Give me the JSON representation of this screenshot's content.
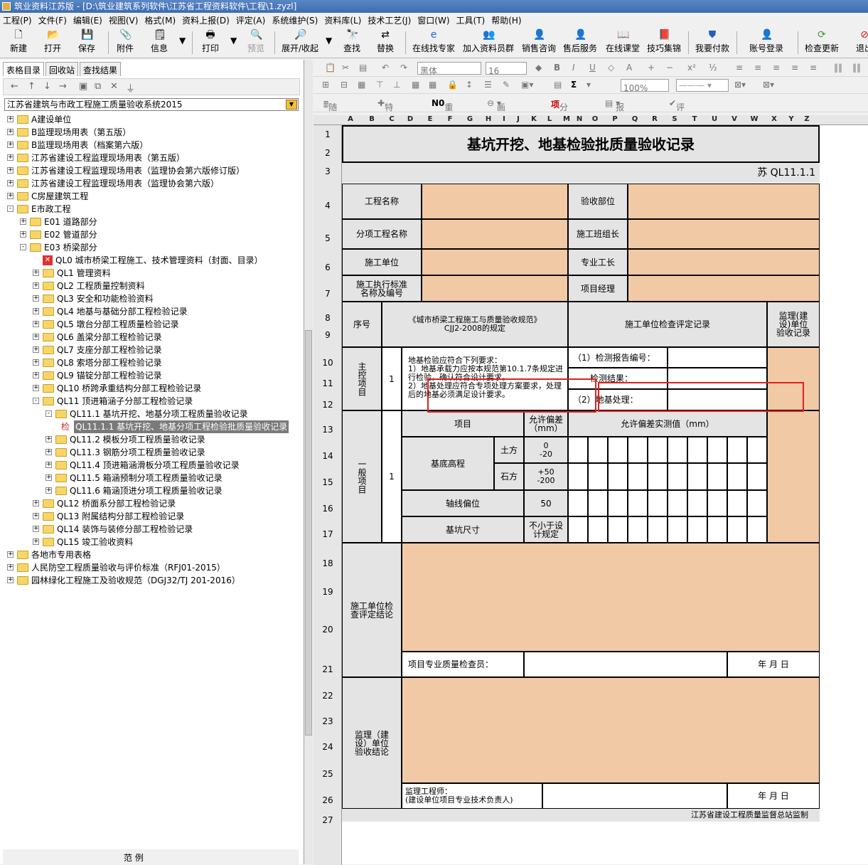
{
  "window": {
    "title": "筑业资料江苏版 - [D:\\筑业建筑系列软件\\江苏省工程资料软件\\工程\\1.zyzl]"
  },
  "menu": [
    "工程(P)",
    "文件(F)",
    "编辑(E)",
    "视图(V)",
    "格式(M)",
    "资料上报(D)",
    "评定(A)",
    "系统维护(S)",
    "资料库(L)",
    "技术工艺(J)",
    "窗口(W)",
    "工具(T)",
    "帮助(H)"
  ],
  "toolbar": {
    "new": "新建",
    "open": "打开",
    "save": "保存",
    "attach": "附件",
    "info": "信息",
    "print": "打印",
    "preview": "预览",
    "expand": "展开/收起",
    "find": "查找",
    "replace": "替换",
    "expert": "在线找专家",
    "group": "加入资料员群",
    "sales": "销售咨询",
    "aftersale": "售后服务",
    "class": "在线课堂",
    "tips": "技巧集锦",
    "pay": "我要付款",
    "account": "账号登录",
    "update": "检查更新",
    "exit": "退出"
  },
  "left": {
    "tabs": [
      "表格目录",
      "回收站",
      "查找结果"
    ],
    "combo": "江苏省建筑与市政工程施工质量验收系统2015",
    "tree": [
      {
        "label": "A建设单位",
        "level": 0,
        "exp": "+"
      },
      {
        "label": "B监理现场用表（第五版）",
        "level": 0,
        "exp": "+"
      },
      {
        "label": "B监理现场用表（档案第六版）",
        "level": 0,
        "exp": "+"
      },
      {
        "label": "江苏省建设工程监理现场用表（第五版）",
        "level": 0,
        "exp": "+"
      },
      {
        "label": "江苏省建设工程监理现场用表（监理协会第六版修订版）",
        "level": 0,
        "exp": "+"
      },
      {
        "label": "江苏省建设工程监理现场用表（监理协会第六版）",
        "level": 0,
        "exp": "+"
      },
      {
        "label": "C房屋建筑工程",
        "level": 0,
        "exp": "+"
      },
      {
        "label": "E市政工程",
        "level": 0,
        "exp": "-"
      },
      {
        "label": "E01 道路部分",
        "level": 1,
        "exp": "+"
      },
      {
        "label": "E02 管道部分",
        "level": 1,
        "exp": "+"
      },
      {
        "label": "E03 桥梁部分",
        "level": 1,
        "exp": "-"
      },
      {
        "label": "QL0 城市桥梁工程施工、技术管理资料（封面、目录）",
        "level": 2,
        "exp": "",
        "x": true
      },
      {
        "label": "QL1 管理资料",
        "level": 2,
        "exp": "+"
      },
      {
        "label": "QL2 工程质量控制资料",
        "level": 2,
        "exp": "+"
      },
      {
        "label": "QL3 安全和功能检验资料",
        "level": 2,
        "exp": "+"
      },
      {
        "label": "QL4 地基与基础分部工程检验记录",
        "level": 2,
        "exp": "+"
      },
      {
        "label": "QL5 墩台分部工程质量检验记录",
        "level": 2,
        "exp": "+"
      },
      {
        "label": "QL6 盖梁分部工程检验记录",
        "level": 2,
        "exp": "+"
      },
      {
        "label": "QL7 支座分部工程检验记录",
        "level": 2,
        "exp": "+"
      },
      {
        "label": "QL8 索塔分部工程检验记录",
        "level": 2,
        "exp": "+"
      },
      {
        "label": "QL9 锚锭分部工程检验记录",
        "level": 2,
        "exp": "+"
      },
      {
        "label": "QL10 桥跨承重结构分部工程检验记录",
        "level": 2,
        "exp": "+"
      },
      {
        "label": "QL11 顶进箱涵子分部工程检验记录",
        "level": 2,
        "exp": "-"
      },
      {
        "label": "QL11.1 基坑开挖、地基分项工程质量验收记录",
        "level": 3,
        "exp": "-"
      },
      {
        "label": "QL11.1.1 基坑开挖、地基分项工程检验批质量验收记录",
        "level": 4,
        "exp": "",
        "sel": true,
        "prefix": "检"
      },
      {
        "label": "QL11.2 模板分项工程质量验收记录",
        "level": 3,
        "exp": "+"
      },
      {
        "label": "QL11.3 钢筋分项工程质量验收记录",
        "level": 3,
        "exp": "+"
      },
      {
        "label": "QL11.4 顶进箱涵滑板分项工程质量验收记录",
        "level": 3,
        "exp": "+"
      },
      {
        "label": "QL11.5 箱涵预制分项工程质量验收记录",
        "level": 3,
        "exp": "+"
      },
      {
        "label": "QL11.6 箱涵顶进分项工程质量验收记录",
        "level": 3,
        "exp": "+"
      },
      {
        "label": "QL12 桥面系分部工程检验记录",
        "level": 2,
        "exp": "+"
      },
      {
        "label": "QL13 附属结构分部工程检验记录",
        "level": 2,
        "exp": "+"
      },
      {
        "label": "QL14 装饰与装修分部工程检验记录",
        "level": 2,
        "exp": "+"
      },
      {
        "label": "QL15 竣工验收资料",
        "level": 2,
        "exp": "+"
      },
      {
        "label": "各地市专用表格",
        "level": 0,
        "exp": "+"
      },
      {
        "label": "人民防空工程质量验收与评价标准（RFJ01-2015）",
        "level": 0,
        "exp": "+"
      },
      {
        "label": "园林绿化工程施工及验收规范（DGJ32/TJ 201-2016）",
        "level": 0,
        "exp": "+"
      }
    ],
    "bottom": "范      例"
  },
  "editor": {
    "font": "黑体",
    "size": "16",
    "zoom": "100%",
    "tb3": {
      "random": "随机数",
      "special": "特殊符号",
      "renum": "重新编号",
      "delline": "画删除线",
      "sub": "分部分项",
      "report": "报验表",
      "eval": "评定"
    },
    "cols": [
      "A",
      "B",
      "C",
      "D",
      "E",
      "F",
      "G",
      "H",
      "I",
      "J",
      "K",
      "L",
      "M",
      "N",
      "O",
      "P",
      "Q",
      "R",
      "S",
      "T",
      "U",
      "V",
      "W",
      "X",
      "Y",
      "Z"
    ],
    "rows": [
      "1",
      "2",
      "3",
      "4",
      "5",
      "6",
      "7",
      "8",
      "9",
      "10",
      "11",
      "12",
      "13",
      "14",
      "15",
      "16",
      "17",
      "18",
      "19",
      "20",
      "21",
      "22",
      "23",
      "24",
      "25",
      "26",
      "27"
    ]
  },
  "form": {
    "title": "基坑开挖、地基检验批质量验收记录",
    "code": "苏 QL11.1.1",
    "proj_name": "工程名称",
    "accept_part": "验收部位",
    "sub_proj": "分项工程名称",
    "team_leader": "施工班组长",
    "constructor": "施工单位",
    "foreman": "专业工长",
    "standard": "施工执行标准名称及编号",
    "pm": "项目经理",
    "seq": "序号",
    "spec": "《城市桥梁工程施工与质量验收规范》CJJ2-2008的规定",
    "check_rec": "施工单位检查评定记录",
    "supervisor_rec": "监理(建设)单位验收记录",
    "main_item": "主控项目",
    "num1": "1",
    "main_text1": "地基检验应符合下列要求：",
    "main_text2": "1）地基承载力应按本规范第10.1.7条规定进行检验，确认符合设计要求。",
    "main_text3": "2）地基处理应符合专项处理方案要求，处理后的地基必须满足设计要求。",
    "report_no": "（1）检测报告编号：",
    "result": "检测结果：",
    "treatment": "（2）地基处理：",
    "general_item": "一般项目",
    "num2": "1",
    "item": "项目",
    "tolerance": "允许偏差（mm）",
    "measured": "允许偏差实测值（mm）",
    "base_elev": "基底高程",
    "earth": "土方",
    "earth_tol": "0\n-20",
    "rock": "石方",
    "rock_tol": "+50\n-200",
    "axis": "轴线偏位",
    "axis_tol": "50",
    "pit_size": "基坑尺寸",
    "pit_tol": "不小于设计规定",
    "constructor_concl": "施工单位检查评定结论",
    "inspector": "项目专业质量检查员：",
    "date1": "年   月   日",
    "supervisor_concl": "监理（建设）单位验收结论",
    "engineer": "监理工程师：\n(建设单位项目专业技术负责人)",
    "date2": "年   月   日",
    "footer": "江苏省建设工程质量监督总站监制"
  }
}
